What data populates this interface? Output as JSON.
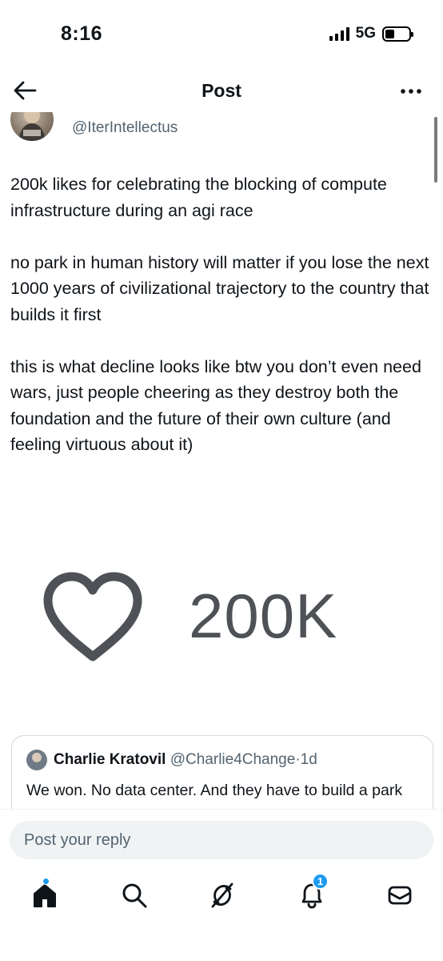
{
  "status_bar": {
    "time": "8:16",
    "network": "5G"
  },
  "nav": {
    "title": "Post"
  },
  "post": {
    "handle": "@IterIntellectus",
    "paragraphs": [
      "200k likes for celebrating the blocking of compute infrastructure during an agi race",
      "no park in human history will matter if you lose the next 1000 years of civilizational trajectory to the country that builds it first",
      "this is what decline looks like btw you don’t even need wars, just people cheering as they destroy both the foundation and the future of their own culture (and feeling virtuous about it)"
    ],
    "media": {
      "like_count": "200K"
    }
  },
  "quote": {
    "name": "Charlie Kratovil",
    "handle": "@Charlie4Change",
    "separator": "·",
    "time": "1d",
    "text": "We won.  No data center.  And they have to build a park"
  },
  "reply": {
    "placeholder": "Post your reply"
  },
  "tabbar": {
    "items": [
      "home-icon",
      "search-icon",
      "grok-icon",
      "notifications-icon",
      "messages-icon"
    ],
    "notification_badge": "1"
  },
  "colors": {
    "accent": "#1d9bf0",
    "text": "#0f1419",
    "muted": "#536471",
    "border": "#cfd9de"
  }
}
